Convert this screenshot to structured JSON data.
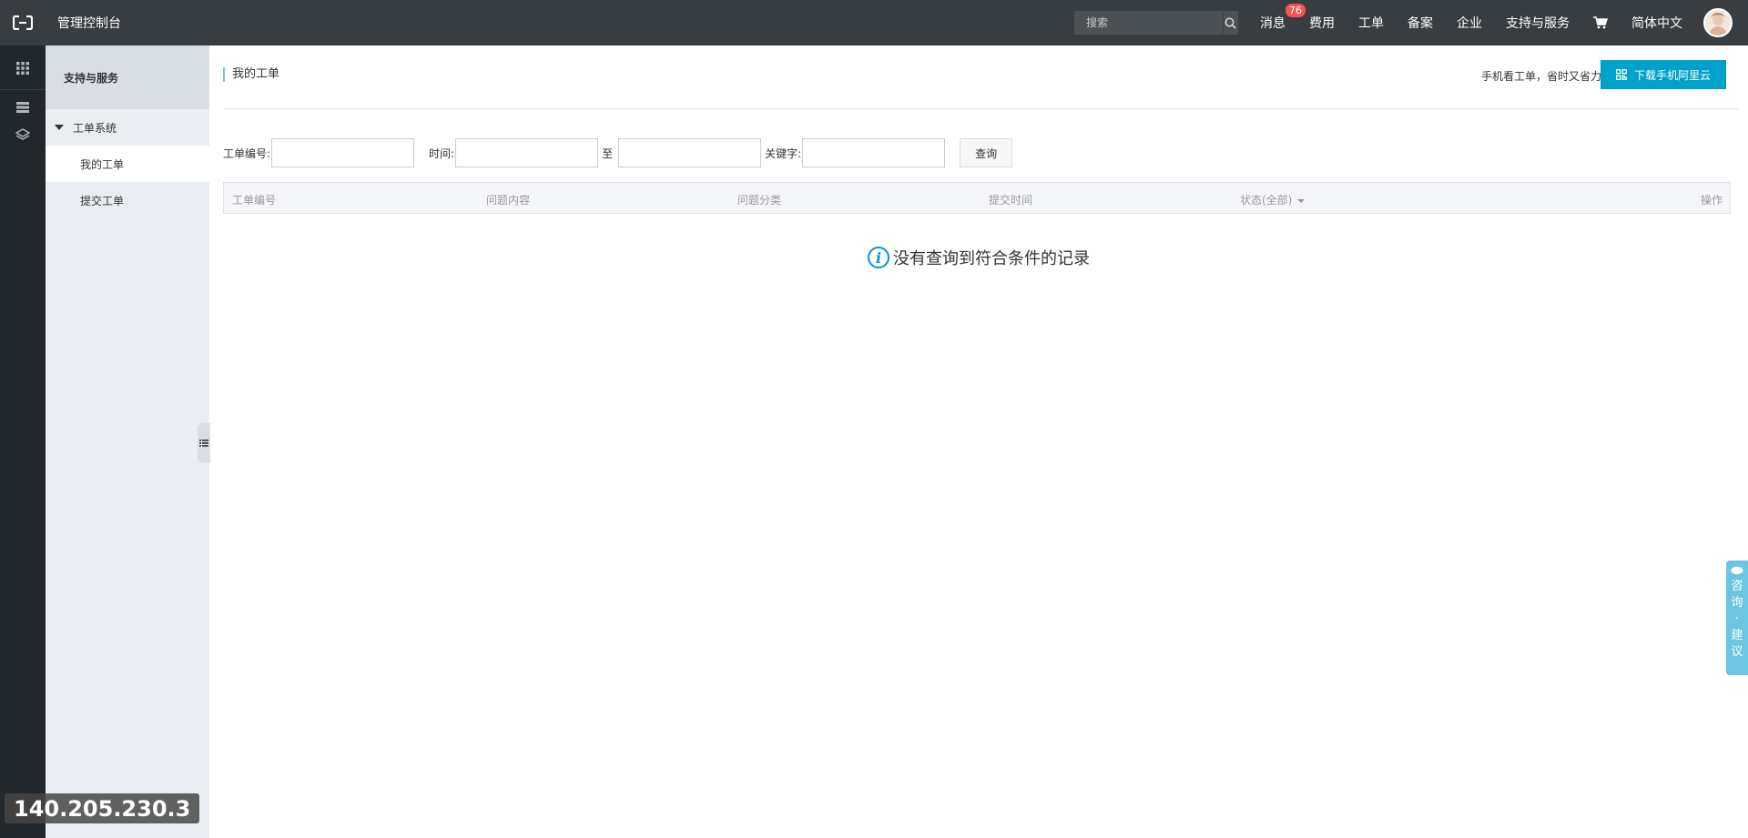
{
  "topbar": {
    "app_title": "管理控制台",
    "search_placeholder": "搜索",
    "nav": {
      "messages": "消息",
      "messages_badge": "76",
      "billing": "费用",
      "ticket": "工单",
      "icp": "备案",
      "enterprise": "企业",
      "support": "支持与服务",
      "language": "简体中文"
    }
  },
  "sidebar": {
    "header": "支持与服务",
    "group": "工单系统",
    "items": [
      {
        "label": "我的工单"
      },
      {
        "label": "提交工单"
      }
    ]
  },
  "page": {
    "title": "我的工单",
    "promo": "手机看工单，省时又省力",
    "download_btn": "下载手机阿里云"
  },
  "filters": {
    "ticket_no_label": "工单编号:",
    "time_label": "时间:",
    "to_label": "至",
    "keyword_label": "关键字:",
    "query_btn": "查询"
  },
  "table": {
    "headers": [
      "工单编号",
      "问题内容",
      "问题分类",
      "提交时间",
      "状态(全部)",
      "操作"
    ]
  },
  "empty_message": "没有查询到符合条件的记录",
  "consult_tab": [
    "咨",
    "询",
    "·",
    "建",
    "议"
  ],
  "overlay_ip": "140.205.230.3",
  "colors": {
    "topbar": "#373d41",
    "rail": "#22272b",
    "sidebar": "#eaedf1",
    "accent": "#00a2ca",
    "badge": "#f45454"
  }
}
